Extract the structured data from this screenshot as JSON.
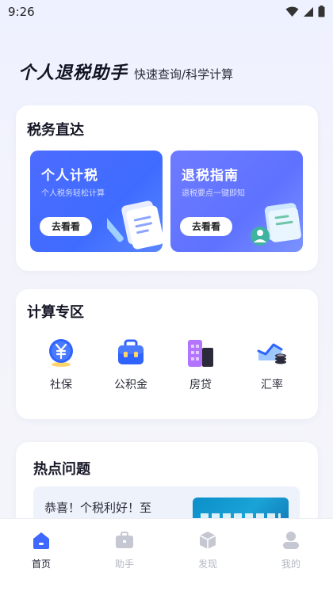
{
  "status_bar": {
    "time": "9:26"
  },
  "header": {
    "title": "个人退税助手",
    "subtitle": "快速查询/科学计算"
  },
  "tax_section": {
    "title": "税务直达",
    "cards": [
      {
        "title": "个人计税",
        "desc": "个人税务轻松计算",
        "button": "去看看"
      },
      {
        "title": "退税指南",
        "desc": "退税要点一键即知",
        "button": "去看看"
      }
    ]
  },
  "calc_section": {
    "title": "计算专区",
    "items": [
      {
        "label": "社保",
        "icon": "yen-coin-icon"
      },
      {
        "label": "公积金",
        "icon": "briefcase-icon"
      },
      {
        "label": "房贷",
        "icon": "building-icon"
      },
      {
        "label": "汇率",
        "icon": "exchange-chart-icon"
      }
    ]
  },
  "hot_section": {
    "title": "热点问题",
    "news": [
      {
        "title": "恭喜！个税利好！至"
      }
    ]
  },
  "tabbar": {
    "items": [
      {
        "label": "首页",
        "icon": "home-icon",
        "active": true
      },
      {
        "label": "助手",
        "icon": "briefcase-icon",
        "active": false
      },
      {
        "label": "发现",
        "icon": "cube-icon",
        "active": false
      },
      {
        "label": "我的",
        "icon": "user-icon",
        "active": false
      }
    ]
  },
  "colors": {
    "primary": "#4168ff",
    "secondary": "#6677ff",
    "background": "#f3f4fb"
  }
}
